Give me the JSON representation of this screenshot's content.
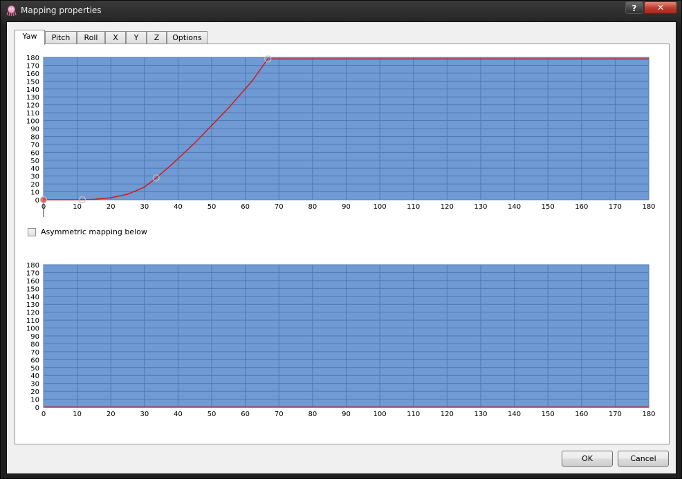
{
  "window": {
    "title": "Mapping properties",
    "help_label": "?",
    "close_label": "✕"
  },
  "tabs": [
    {
      "label": "Yaw",
      "active": true
    },
    {
      "label": "Pitch",
      "active": false
    },
    {
      "label": "Roll",
      "active": false
    },
    {
      "label": "X",
      "active": false
    },
    {
      "label": "Y",
      "active": false
    },
    {
      "label": "Z",
      "active": false
    },
    {
      "label": "Options",
      "active": false
    }
  ],
  "checkbox": {
    "label": "Asymmetric mapping below",
    "checked": false
  },
  "buttons": {
    "ok": "OK",
    "cancel": "Cancel"
  },
  "colors": {
    "plot_bg": "#6f9ad3",
    "grid": "#4f78b2",
    "curve": "#d11a1a",
    "point": "#c0c0c0"
  },
  "chart_data": [
    {
      "type": "line",
      "xlim": [
        0,
        180
      ],
      "ylim": [
        0,
        180
      ],
      "xticks": [
        0,
        10,
        20,
        30,
        40,
        50,
        60,
        70,
        80,
        90,
        100,
        110,
        120,
        130,
        140,
        150,
        160,
        170,
        180
      ],
      "yticks": [
        0,
        10,
        20,
        30,
        40,
        50,
        60,
        70,
        80,
        90,
        100,
        110,
        120,
        130,
        140,
        150,
        160,
        170,
        180
      ],
      "control_points": [
        [
          0,
          0
        ],
        [
          11.5,
          0
        ],
        [
          33.5,
          27.5
        ],
        [
          66.7,
          178
        ]
      ],
      "curve": [
        [
          0,
          0
        ],
        [
          11.5,
          0
        ],
        [
          15,
          0.5
        ],
        [
          20,
          2.5
        ],
        [
          25,
          7
        ],
        [
          30,
          16
        ],
        [
          33.5,
          27.5
        ],
        [
          38,
          44
        ],
        [
          45,
          72
        ],
        [
          55,
          116
        ],
        [
          62,
          150
        ],
        [
          66.7,
          178
        ],
        [
          180,
          178
        ]
      ],
      "grid": true
    },
    {
      "type": "line",
      "xlim": [
        0,
        180
      ],
      "ylim": [
        0,
        180
      ],
      "xticks": [
        0,
        10,
        20,
        30,
        40,
        50,
        60,
        70,
        80,
        90,
        100,
        110,
        120,
        130,
        140,
        150,
        160,
        170,
        180
      ],
      "yticks": [
        0,
        10,
        20,
        30,
        40,
        50,
        60,
        70,
        80,
        90,
        100,
        110,
        120,
        130,
        140,
        150,
        160,
        170,
        180
      ],
      "control_points": [],
      "curve": [
        [
          0,
          0
        ],
        [
          180,
          0
        ]
      ],
      "grid": true
    }
  ]
}
